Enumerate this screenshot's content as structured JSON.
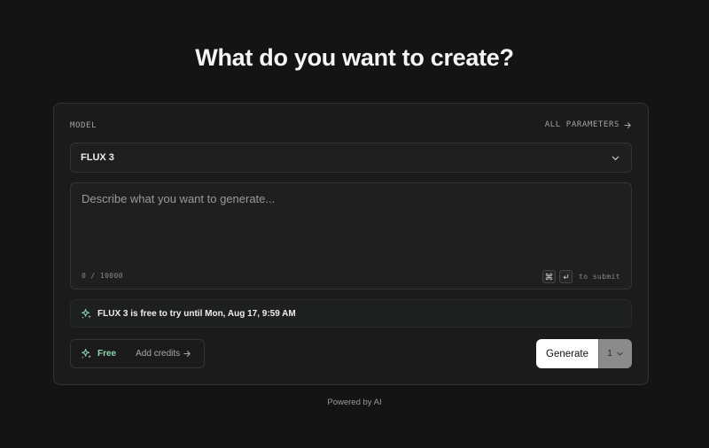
{
  "page": {
    "heading": "What do you want to create?",
    "footer": "Powered by AI"
  },
  "form": {
    "model_label": "MODEL",
    "all_parameters_label": "ALL PARAMETERS",
    "model_value": "FLUX 3",
    "prompt_value": "",
    "prompt_placeholder": "Describe what you want to generate...",
    "char_count": "0 / 10000",
    "submit_hint": "to submit",
    "notice_text": "FLUX 3 is free to try until Mon, Aug 17, 9:59 AM",
    "plan_label": "Free",
    "add_credits_label": "Add credits",
    "generate_label": "Generate",
    "image_count": "1"
  },
  "icons": {
    "arrow_right": "arrow-right-icon",
    "chevron_down": "chevron-down-icon",
    "command_key": "command-key-icon",
    "enter_key": "enter-key-icon",
    "sparkle": "sparkle-icon"
  },
  "colors": {
    "background": "#141414",
    "card": "#1b1b1b",
    "accent_green": "#8fd4b0",
    "generate_button": "#ffffff",
    "count_select": "#8b8b8b"
  }
}
